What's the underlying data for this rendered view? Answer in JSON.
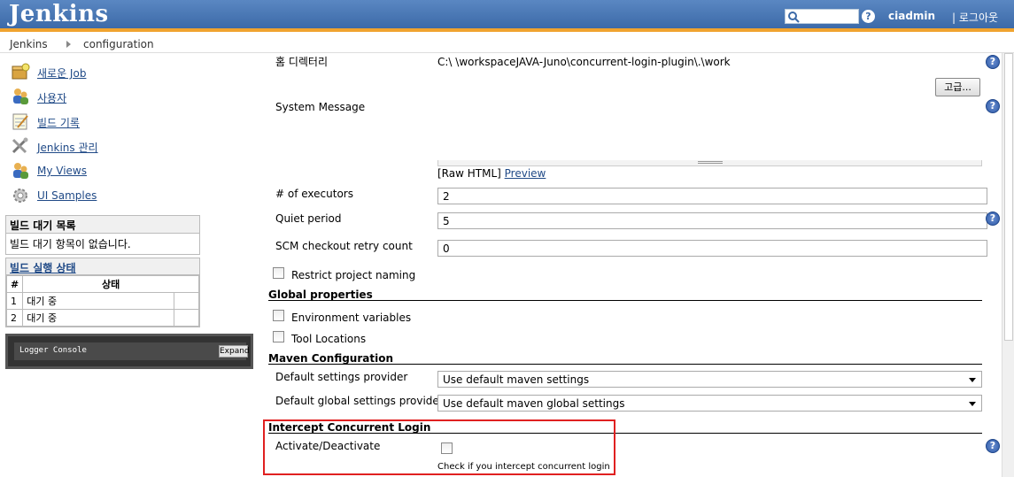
{
  "header": {
    "logo": "Jenkins",
    "help": "?",
    "user": "ciadmin",
    "logout": "| 로그아웃"
  },
  "breadcrumb": [
    "Jenkins",
    "configuration"
  ],
  "sidebar": {
    "items": [
      {
        "label": "새로운 Job",
        "icon": "new-job-icon"
      },
      {
        "label": "사용자",
        "icon": "users-icon"
      },
      {
        "label": "빌드 기록",
        "icon": "notepad-icon"
      },
      {
        "label": "Jenkins 관리",
        "icon": "tools-icon"
      },
      {
        "label": "My Views",
        "icon": "users-icon"
      },
      {
        "label": "UI Samples",
        "icon": "gear-icon"
      }
    ],
    "queue": {
      "title": "빌드 대기 목록",
      "empty": "빌드 대기 항목이 없습니다."
    },
    "executors": {
      "title": "빌드 실행 상태",
      "col_num": "#",
      "col_status": "상태",
      "rows": [
        {
          "num": "1",
          "status": "대기 중"
        },
        {
          "num": "2",
          "status": "대기 중"
        }
      ]
    },
    "logger": {
      "title": "Logger Console",
      "expand": "Expand"
    }
  },
  "form": {
    "home_dir_label": "홈 디렉터리",
    "home_dir_value": "C:\\       \\workspaceJAVA-Juno\\concurrent-login-plugin\\.\\work",
    "advanced_button": "고급...",
    "system_message_label": "System Message",
    "raw_html": "[Raw HTML]",
    "preview": "Preview",
    "executors_label": "# of executors",
    "executors_value": "2",
    "quiet_label": "Quiet period",
    "quiet_value": "5",
    "scm_label": "SCM checkout retry count",
    "scm_value": "0",
    "restrict_label": "Restrict project naming",
    "global_props_title": "Global properties",
    "env_vars_label": "Environment variables",
    "tool_locations_label": "Tool Locations",
    "maven_title": "Maven Configuration",
    "default_settings_label": "Default settings provider",
    "default_settings_value": "Use default maven settings",
    "global_settings_label": "Default global settings provider",
    "global_settings_value": "Use default maven global settings",
    "intercept_title": "Intercept Concurrent Login",
    "activate_label": "Activate/Deactivate",
    "activate_hint": "Check if you intercept concurrent login"
  }
}
